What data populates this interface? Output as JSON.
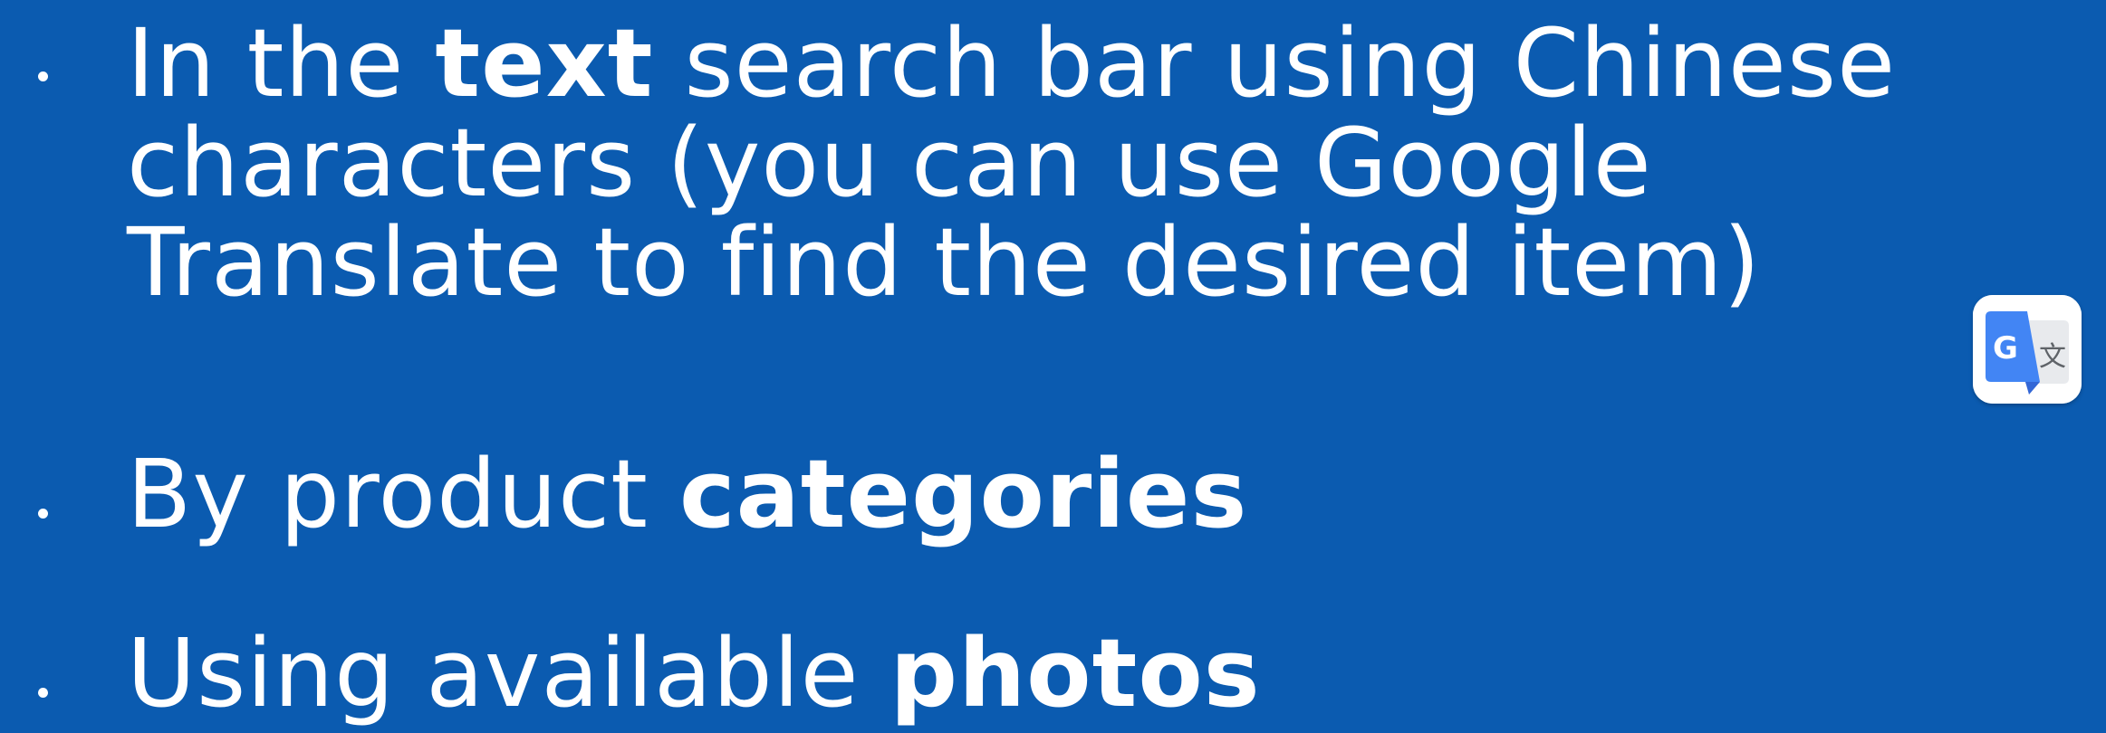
{
  "slide": {
    "bullets": [
      {
        "lines": [
          {
            "parts": [
              {
                "text": "In the ",
                "bold": false
              },
              {
                "text": "text",
                "bold": true
              },
              {
                "text": " search bar using Chinese",
                "bold": false
              }
            ]
          },
          {
            "parts": [
              {
                "text": "characters (you can use Google",
                "bold": false
              }
            ]
          },
          {
            "parts": [
              {
                "text": "Translate to find the desired item)",
                "bold": false
              }
            ]
          }
        ]
      },
      {
        "lines": [
          {
            "parts": [
              {
                "text": "By product ",
                "bold": false
              },
              {
                "text": "categories",
                "bold": true
              }
            ]
          }
        ]
      },
      {
        "lines": [
          {
            "parts": [
              {
                "text": "Using available ",
                "bold": false
              },
              {
                "text": "photos",
                "bold": true
              }
            ]
          }
        ]
      }
    ],
    "icon": {
      "name": "google-translate-icon",
      "glyph_left": "G",
      "glyph_right": "文"
    }
  },
  "colors": {
    "background": "#0b5bb0",
    "text": "#ffffff",
    "icon_blue": "#4285f4",
    "icon_gray": "#e8eaed",
    "icon_dark_blue": "#3367d6"
  }
}
